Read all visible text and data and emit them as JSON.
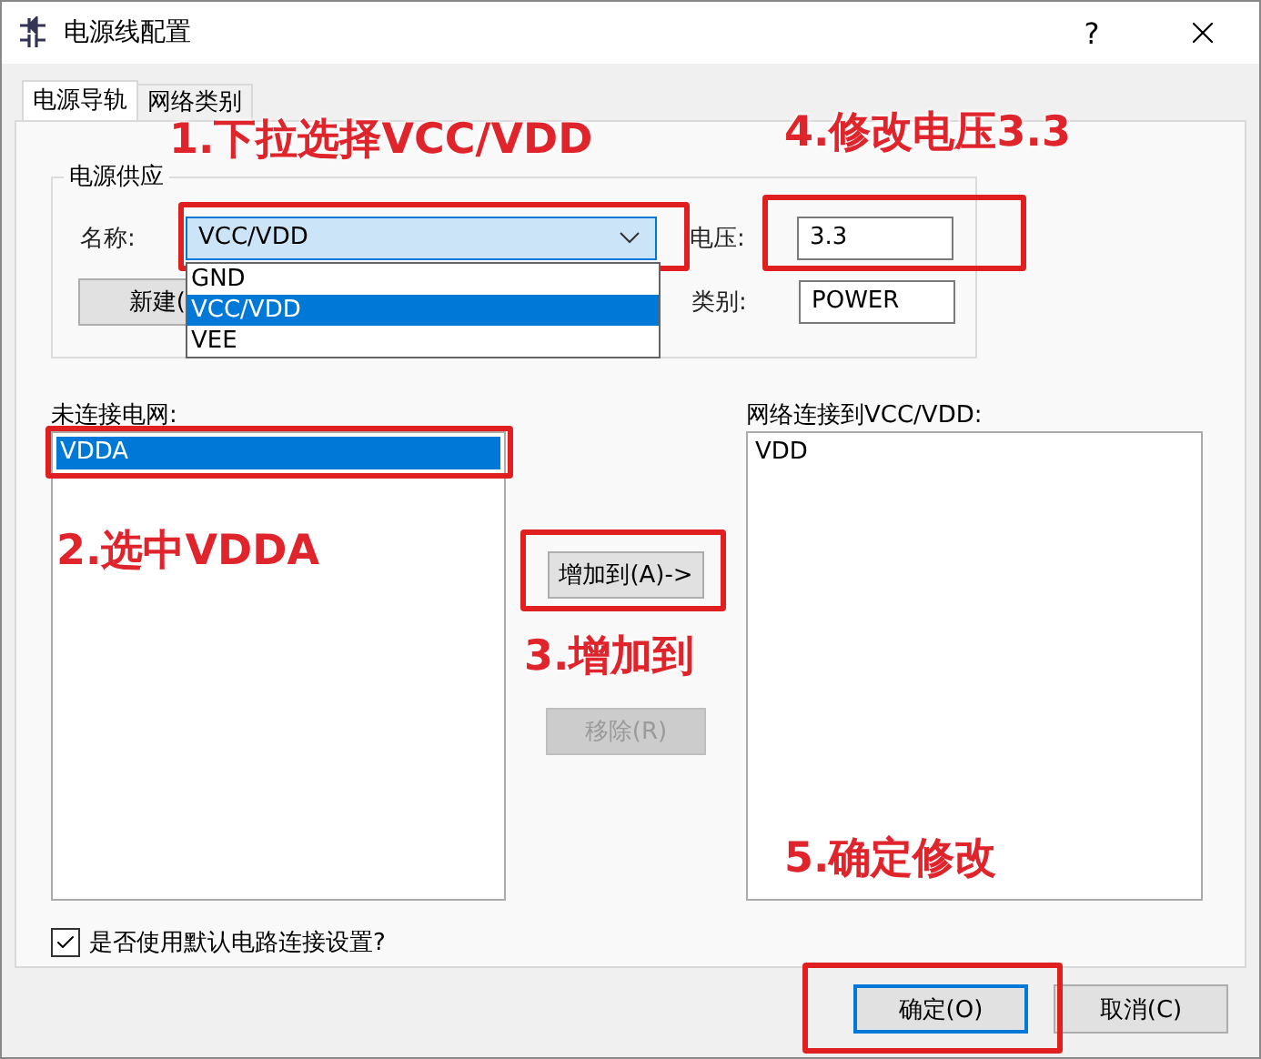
{
  "window": {
    "title": "电源线配置",
    "help": "?"
  },
  "tabs": [
    {
      "label": "电源导轨",
      "selected": true
    },
    {
      "label": "网络类别",
      "selected": false
    }
  ],
  "supply": {
    "group_title": "电源供应",
    "name_label": "名称:",
    "name_value": "VCC/VDD",
    "new_button": "新建(",
    "voltage_label": "电压:",
    "voltage_value": "3.3",
    "class_label": "类别:",
    "class_value": "POWER",
    "dropdown_options": [
      {
        "label": "GND",
        "selected": false
      },
      {
        "label": "VCC/VDD",
        "selected": true
      },
      {
        "label": "VEE",
        "selected": false
      }
    ]
  },
  "unconnected": {
    "label": "未连接电网:",
    "items": [
      {
        "label": "VDDA",
        "selected": true
      }
    ]
  },
  "connected": {
    "label": "网络连接到VCC/VDD:",
    "items": [
      {
        "label": "VDD",
        "selected": false
      }
    ]
  },
  "add_button": {
    "label": "增加到(A)->",
    "disabled": false
  },
  "remove_button": {
    "label": "移除(R)",
    "disabled": true
  },
  "default_check": {
    "label": "是否使用默认电路连接设置?",
    "checked": true
  },
  "buttons": [
    {
      "label": "确定(O)",
      "focused": true
    },
    {
      "label": "取消(C)",
      "focused": false
    }
  ],
  "annotations": [
    "1.下拉选择VCC/VDD",
    "4.修改电压3.3",
    "2.选中VDDA",
    "3.增加到",
    "5.确定修改"
  ]
}
